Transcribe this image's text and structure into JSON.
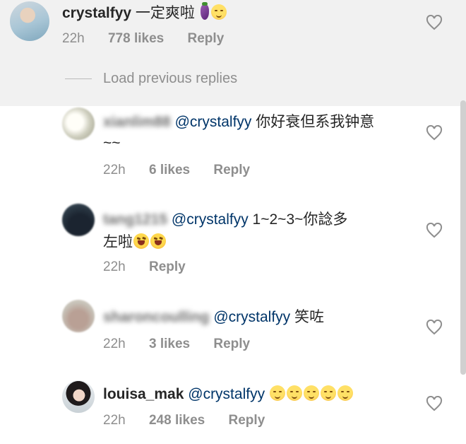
{
  "comments": {
    "main": {
      "username": "crystalfyy",
      "text": "一定爽啦",
      "time": "22h",
      "likes": "778 likes",
      "reply": "Reply"
    },
    "load_previous": "Load previous replies",
    "replies": [
      {
        "username": "xianlim88",
        "mention": "@crystalfyy",
        "text": " 你好衰但系我钟意",
        "text_line2": "~~",
        "time": "22h",
        "likes": "6 likes",
        "reply": "Reply"
      },
      {
        "username": "tang1215",
        "mention": "@crystalfyy",
        "text": " 1~2~3~你諗多",
        "text_line2": "左啦",
        "time": "22h",
        "reply": "Reply"
      },
      {
        "username": "sharoncoulling",
        "mention": "@crystalfyy",
        "text": " 笑咗",
        "time": "22h",
        "likes": "3 likes",
        "reply": "Reply"
      },
      {
        "username": "louisa_mak",
        "mention": "@crystalfyy",
        "time": "22h",
        "likes": "248 likes",
        "reply": "Reply"
      }
    ]
  },
  "icons": {
    "like": "heart-outline-icon",
    "smile": "smiling-face-emoji",
    "laugh": "rolling-laughing-emoji",
    "eggplant": "eggplant-emoji"
  },
  "colors": {
    "mention": "#003569",
    "meta": "#8e8e8e",
    "text": "#262626",
    "top_band": "#f1f1f1"
  }
}
